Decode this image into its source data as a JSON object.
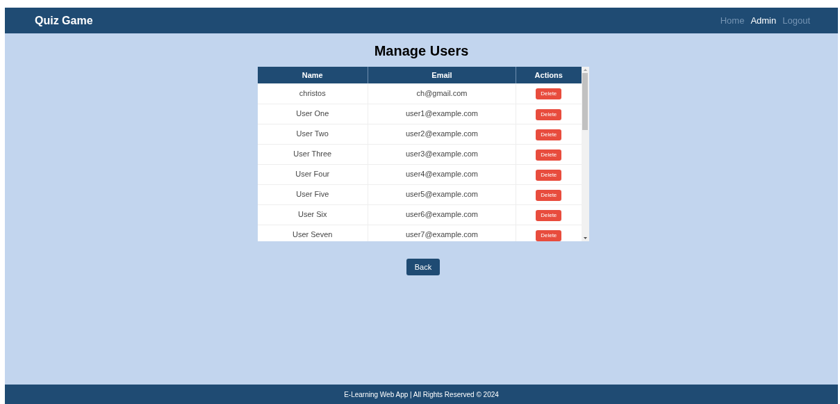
{
  "navbar": {
    "brand": "Quiz Game",
    "links": [
      {
        "label": "Home",
        "selected": false
      },
      {
        "label": "Admin",
        "selected": true
      },
      {
        "label": "Logout",
        "selected": false
      }
    ]
  },
  "title": "Manage Users",
  "table": {
    "columns": [
      "Name",
      "Email",
      "Actions"
    ],
    "rows": [
      {
        "name": "christos",
        "email": "ch@gmail.com",
        "action": "Delete"
      },
      {
        "name": "User One",
        "email": "user1@example.com",
        "action": "Delete"
      },
      {
        "name": "User Two",
        "email": "user2@example.com",
        "action": "Delete"
      },
      {
        "name": "User Three",
        "email": "user3@example.com",
        "action": "Delete"
      },
      {
        "name": "User Four",
        "email": "user4@example.com",
        "action": "Delete"
      },
      {
        "name": "User Five",
        "email": "user5@example.com",
        "action": "Delete"
      },
      {
        "name": "User Six",
        "email": "user6@example.com",
        "action": "Delete"
      },
      {
        "name": "User Seven",
        "email": "user7@example.com",
        "action": "Delete"
      }
    ]
  },
  "back_button": "Back",
  "footer": "E-Learning Web App | All Rights Reserved © 2024"
}
